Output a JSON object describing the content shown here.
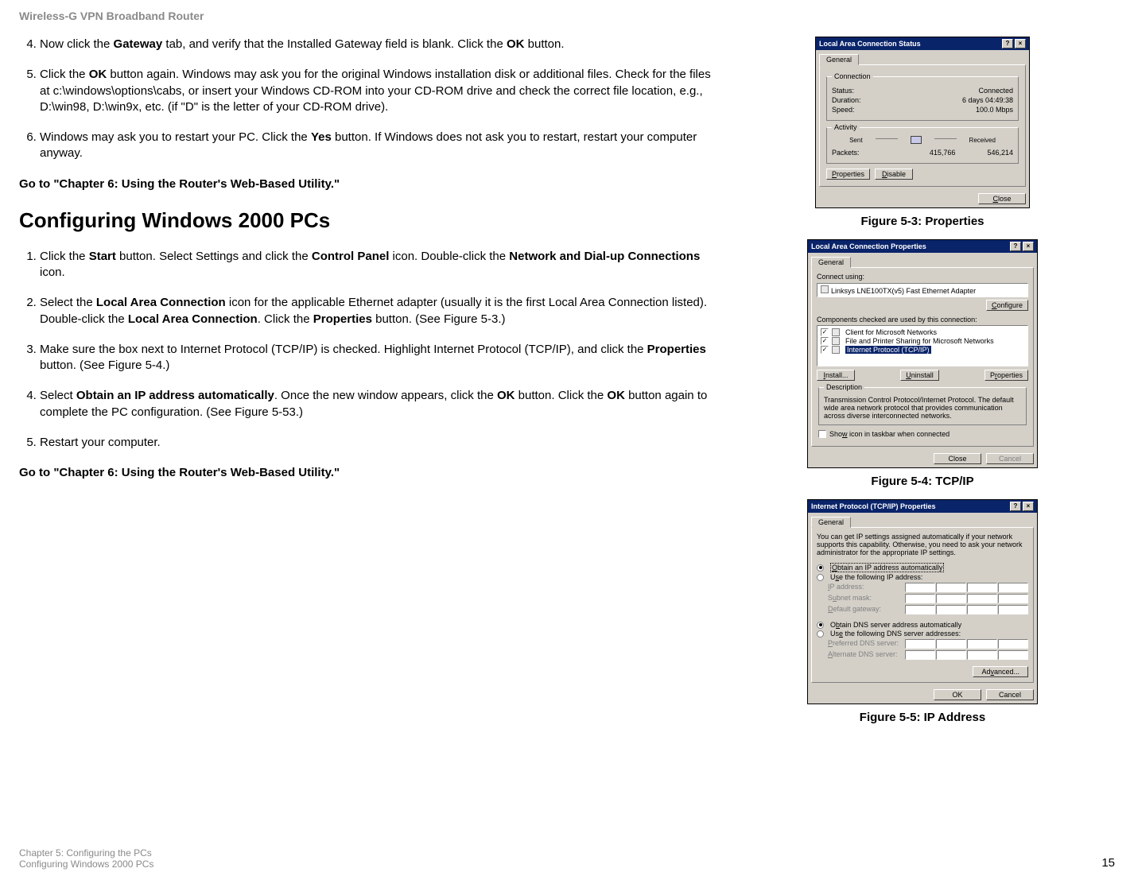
{
  "doc_header": "Wireless-G VPN Broadband Router",
  "list1": {
    "i4": "Now click the Gateway tab, and verify that the Installed Gateway field is  blank. Click the OK button.",
    "i5": "Click the OK button again. Windows may ask you for the original Windows installation disk or additional files. Check for the files at c:\\windows\\options\\cabs, or insert your Windows CD-ROM into your CD-ROM drive and check the correct file location, e.g., D:\\win98, D:\\win9x, etc. (if \"D\" is the letter of your CD-ROM drive).",
    "i6": "Windows may ask you to restart your PC. Click the Yes button. If Windows does not ask you to restart, restart your computer anyway."
  },
  "goto1": "Go to \"Chapter 6: Using the Router's Web-Based Utility.\"",
  "heading2": "Configuring Windows 2000 PCs",
  "list2": {
    "i1": "Click the Start button. Select Settings and click the Control Panel icon.  Double-click the Network and Dial-up Connections icon.",
    "i2": "Select the Local Area Connection icon for the applicable Ethernet adapter (usually it is the first Local Area Connection listed). Double-click the Local Area Connection. Click the Properties button. (See Figure 5-3.)",
    "i3": "Make sure the box next to Internet Protocol (TCP/IP) is checked. Highlight Internet Protocol (TCP/IP), and click the Properties button. (See Figure 5-4.)",
    "i4": "Select Obtain an IP address automatically. Once the new window appears, click the OK button. Click the OK button again to complete the PC configuration. (See Figure 5-53.)",
    "i5": "Restart your computer."
  },
  "goto2": "Go to \"Chapter 6: Using the Router's Web-Based Utility.\"",
  "fig53_caption": "Figure 5-3: Properties",
  "fig54_caption": "Figure 5-4: TCP/IP",
  "fig55_caption": "Figure 5-5: IP Address",
  "dlg1": {
    "title": "Local Area Connection Status",
    "tab": "General",
    "grp_conn": "Connection",
    "status_l": "Status:",
    "status_v": "Connected",
    "dur_l": "Duration:",
    "dur_v": "6 days 04:49:38",
    "speed_l": "Speed:",
    "speed_v": "100.0 Mbps",
    "grp_act": "Activity",
    "sent": "Sent",
    "recv": "Received",
    "packets_l": "Packets:",
    "packets_sent": "415,766",
    "packets_recv": "546,214",
    "btn_props": "Properties",
    "btn_disable": "Disable",
    "btn_close": "Close"
  },
  "dlg2": {
    "title": "Local Area Connection Properties",
    "tab": "General",
    "connect_using": "Connect using:",
    "adapter": "Linksys LNE100TX(v5) Fast Ethernet Adapter",
    "btn_conf": "Configure",
    "components_lbl": "Components checked are used by this connection:",
    "c1": "Client for Microsoft Networks",
    "c2": "File and Printer Sharing for Microsoft Networks",
    "c3": "Internet Protocol (TCP/IP)",
    "btn_install": "Install...",
    "btn_uninstall": "Uninstall",
    "btn_props": "Properties",
    "grp_desc": "Description",
    "desc_text": "Transmission Control Protocol/Internet Protocol. The default wide area network protocol that provides communication across diverse interconnected networks.",
    "show_icon": "Show icon in taskbar when connected",
    "btn_close": "Close",
    "btn_cancel": "Cancel"
  },
  "dlg3": {
    "title": "Internet Protocol (TCP/IP) Properties",
    "tab": "General",
    "intro": "You can get IP settings assigned automatically if your network supports this capability. Otherwise, you need to ask your network administrator for the appropriate IP settings.",
    "r1": "Obtain an IP address automatically",
    "r2": "Use the following IP address:",
    "ip_l": "IP address:",
    "mask_l": "Subnet mask:",
    "gw_l": "Default gateway:",
    "r3": "Obtain DNS server address automatically",
    "r4": "Use the following DNS server addresses:",
    "dns1_l": "Preferred DNS server:",
    "dns2_l": "Alternate DNS server:",
    "btn_adv": "Advanced...",
    "btn_ok": "OK",
    "btn_cancel": "Cancel"
  },
  "footer": {
    "line1": "Chapter 5: Configuring the PCs",
    "line2": "Configuring Windows 2000 PCs",
    "page": "15"
  }
}
